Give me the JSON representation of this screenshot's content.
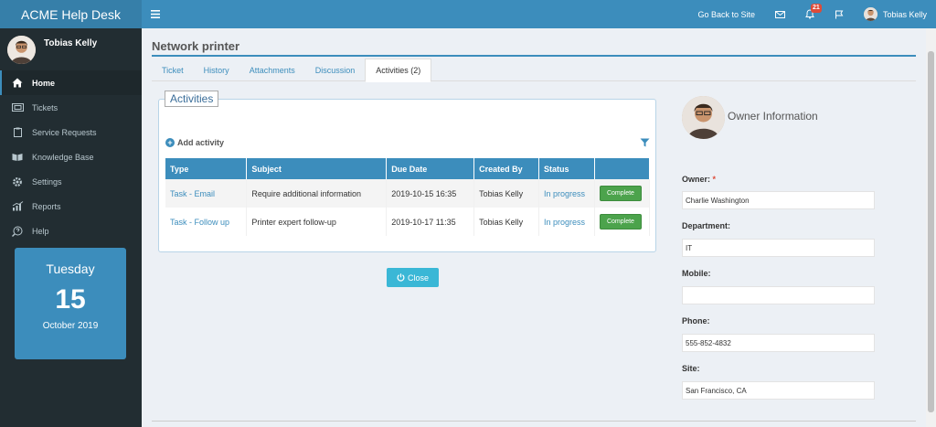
{
  "app": {
    "brand": "ACME Help Desk"
  },
  "topbar": {
    "go_back": "Go Back to Site",
    "notifications_count": "21",
    "user_name": "Tobias Kelly"
  },
  "sidebar": {
    "user_name": "Tobias Kelly",
    "items": [
      {
        "label": "Home",
        "icon": "home-icon"
      },
      {
        "label": "Tickets",
        "icon": "ticket-icon"
      },
      {
        "label": "Service Requests",
        "icon": "clipboard-icon"
      },
      {
        "label": "Knowledge Base",
        "icon": "book-icon"
      },
      {
        "label": "Settings",
        "icon": "gear-icon"
      },
      {
        "label": "Reports",
        "icon": "chart-icon"
      },
      {
        "label": "Help",
        "icon": "help-icon"
      }
    ],
    "date": {
      "day": "Tuesday",
      "num": "15",
      "month": "October 2019"
    }
  },
  "page": {
    "title": "Network printer",
    "tabs": [
      "Ticket",
      "History",
      "Attachments",
      "Discussion",
      "Activities (2)"
    ],
    "active_tab": 4
  },
  "activities": {
    "legend": "Activities",
    "add_label": "Add activity",
    "columns": [
      "Type",
      "Subject",
      "Due Date",
      "Created By",
      "Status",
      ""
    ],
    "rows": [
      {
        "type": "Task - Email",
        "subject": "Require additional information",
        "due": "2019-10-15 16:35",
        "created_by": "Tobias Kelly",
        "status": "In progress",
        "action": "Complete"
      },
      {
        "type": "Task - Follow up",
        "subject": "Printer expert follow-up",
        "due": "2019-10-17 11:35",
        "created_by": "Tobias Kelly",
        "status": "In progress",
        "action": "Complete"
      }
    ],
    "close_label": "Close"
  },
  "owner": {
    "title": "Owner Information",
    "owner_label": "Owner:",
    "owner_required": "*",
    "owner_value": "Charlie Washington",
    "department_label": "Department:",
    "department_value": "IT",
    "mobile_label": "Mobile:",
    "mobile_value": "",
    "phone_label": "Phone:",
    "phone_value": "555-852-4832",
    "site_label": "Site:",
    "site_value": "San Francisco, CA"
  },
  "colors": {
    "primary": "#3c8dbc",
    "sidebar": "#222d32",
    "success": "#4ca34c",
    "close": "#3ab7d6"
  }
}
